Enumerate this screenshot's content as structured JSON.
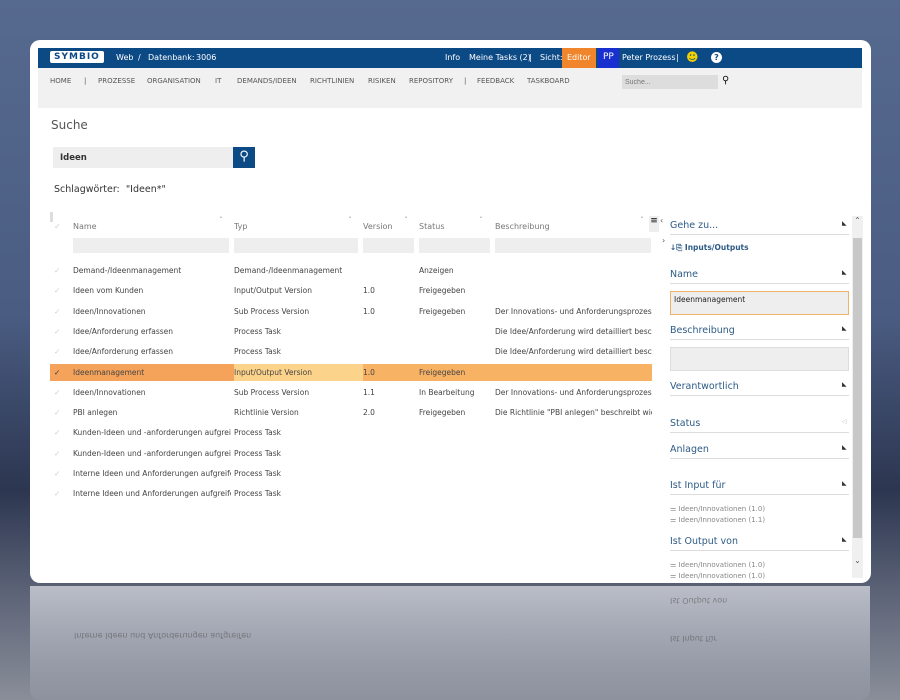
{
  "header": {
    "logo": "SYMBIO",
    "web": "Web",
    "sep": "/",
    "db_label": "Datenbank:",
    "db_number": "3006",
    "info": "Info",
    "tasks": "Meine Tasks (2)",
    "pipe": "|",
    "view_label": "Sicht:",
    "view": "Editor",
    "user_initials": "PP",
    "user_name": "Peter Prozess",
    "smiley": "☻",
    "help": "?"
  },
  "nav": {
    "items": [
      "HOME",
      "|",
      "PROZESSE",
      "ORGANISATION",
      "IT",
      "DEMANDS/IDEEN",
      "RICHTLINIEN",
      "RISIKEN",
      "REPOSITORY",
      "|",
      "FEEDBACK",
      "TASKBOARD"
    ],
    "search_placeholder": "Suche..."
  },
  "page": {
    "title": "Suche",
    "query": "Ideen",
    "keywords_label": "Schlagwörter:",
    "keywords": "\"Ideen*\""
  },
  "table": {
    "columns": [
      "Name",
      "Typ",
      "Version",
      "Status",
      "Beschreibung"
    ],
    "rows": [
      {
        "name": "Demand-/Ideenmanagement",
        "typ": "Demand-/Ideenmanagement",
        "version": "",
        "status": "Anzeigen",
        "desc": "",
        "selected": false
      },
      {
        "name": "Ideen vom Kunden",
        "typ": "Input/Output Version",
        "version": "1.0",
        "status": "Freigegeben",
        "desc": "",
        "selected": false
      },
      {
        "name": "Ideen/Innovationen",
        "typ": "Sub Process Version",
        "version": "1.0",
        "status": "Freigegeben",
        "desc": "Der Innovations- und Anforderungsprozes...",
        "selected": false
      },
      {
        "name": "Idee/Anforderung erfassen",
        "typ": "Process Task",
        "version": "",
        "status": "",
        "desc": "Die Idee/Anforderung wird detailliert besc...",
        "selected": false
      },
      {
        "name": "Idee/Anforderung erfassen",
        "typ": "Process Task",
        "version": "",
        "status": "",
        "desc": "Die Idee/Anforderung wird detailliert besc...",
        "selected": false
      },
      {
        "name": "Ideenmanagement",
        "typ": "Input/Output Version",
        "version": "1.0",
        "status": "Freigegeben",
        "desc": "",
        "selected": true
      },
      {
        "name": "Ideen/Innovationen",
        "typ": "Sub Process Version",
        "version": "1.1",
        "status": "In Bearbeitung",
        "desc": "Der Innovations- und Anforderungsprozes...",
        "selected": false
      },
      {
        "name": "PBI anlegen",
        "typ": "Richtlinie Version",
        "version": "2.0",
        "status": "Freigegeben",
        "desc": "Die Richtlinie \"PBI anlegen\" beschreibt wie...",
        "selected": false
      },
      {
        "name": "Kunden-Ideen und -anforderungen aufgrei...",
        "typ": "Process Task",
        "version": "",
        "status": "",
        "desc": "",
        "selected": false
      },
      {
        "name": "Kunden-Ideen und -anforderungen aufgrei...",
        "typ": "Process Task",
        "version": "",
        "status": "",
        "desc": "",
        "selected": false
      },
      {
        "name": "Interne Ideen und Anforderungen aufgreifen",
        "typ": "Process Task",
        "version": "",
        "status": "",
        "desc": "",
        "selected": false
      },
      {
        "name": "Interne Ideen und Anforderungen aufgreifen",
        "typ": "Process Task",
        "version": "",
        "status": "",
        "desc": "",
        "selected": false
      }
    ]
  },
  "panel": {
    "goto": "Gehe zu...",
    "io_link": "Inputs/Outputs",
    "name_label": "Name",
    "name_value": "Ideenmanagement",
    "desc_label": "Beschreibung",
    "resp_label": "Verantwortlich",
    "status_label": "Status",
    "attach_label": "Anlagen",
    "input_label": "Ist Input für",
    "inputs": [
      "Ideen/Innovationen (1.0)",
      "Ideen/Innovationen (1.1)"
    ],
    "output_label": "Ist Output von",
    "outputs": [
      "Ideen/Innovationen (1.0)",
      "Ideen/Innovationen (1.0)"
    ]
  },
  "colors": {
    "brand": "#0c4a86",
    "editor": "#f0852b",
    "selected_row": "#f8b264"
  }
}
